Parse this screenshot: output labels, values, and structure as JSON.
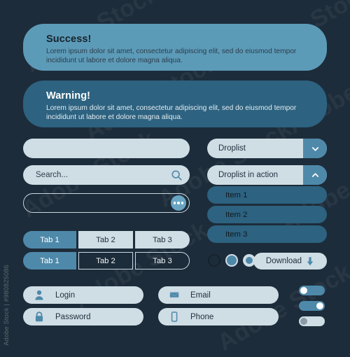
{
  "theme": {
    "background": "#1d2c3a",
    "accent": "#4e89aa",
    "light_surface": "#cfdde5",
    "success_bg": "#5c9bb8",
    "warning_bg": "#2d6280"
  },
  "alerts": [
    {
      "name": "success",
      "title": "Success!",
      "body": "Lorem ipsum dolor sit amet, consectetur adipiscing elit, sed do eiusmod tempor incididunt ut labore et dolore magna aliqua."
    },
    {
      "name": "warning",
      "title": "Warning!",
      "body": "Lorem ipsum dolor sit amet, consectetur adipiscing elit, sed do eiusmod tempor incididunt ut labore et dolore magna aliqua."
    }
  ],
  "inputs": {
    "blank_value": "",
    "search_placeholder": "Search...",
    "search_icon": "search-icon",
    "outline_value": "",
    "more_icon": "ellipsis-icon"
  },
  "droplists": [
    {
      "label": "Droplist",
      "state": "collapsed",
      "icon": "chevron-down-icon"
    },
    {
      "label": "Droplist in action",
      "state": "expanded",
      "icon": "chevron-up-icon"
    }
  ],
  "droplist_items": [
    {
      "label": "Item 1"
    },
    {
      "label": "Item 2"
    },
    {
      "label": "Item 3"
    }
  ],
  "tabs": {
    "row_filled": [
      {
        "label": "Tab 1",
        "active": true
      },
      {
        "label": "Tab 2",
        "active": false
      },
      {
        "label": "Tab 3",
        "active": false
      }
    ],
    "row_outlined": [
      {
        "label": "Tab 1",
        "active": true
      },
      {
        "label": "Tab 2",
        "active": false
      },
      {
        "label": "Tab 3",
        "active": false
      }
    ]
  },
  "radios": [
    {
      "state": "empty"
    },
    {
      "state": "ring"
    },
    {
      "state": "selected"
    }
  ],
  "download": {
    "label": "Download",
    "icon": "download-arrow-icon"
  },
  "fields": [
    {
      "label": "Login",
      "icon": "user-icon"
    },
    {
      "label": "Password",
      "icon": "lock-icon"
    },
    {
      "label": "Email",
      "icon": "envelope-icon"
    },
    {
      "label": "Phone",
      "icon": "phone-icon"
    }
  ],
  "toggles": [
    {
      "state": "on-left",
      "enabled": true
    },
    {
      "state": "on-right",
      "enabled": true
    },
    {
      "state": "off",
      "enabled": false
    }
  ],
  "watermarks": {
    "tile": "Adobe Stock",
    "credit": "Adobe Stock | #980825086"
  }
}
